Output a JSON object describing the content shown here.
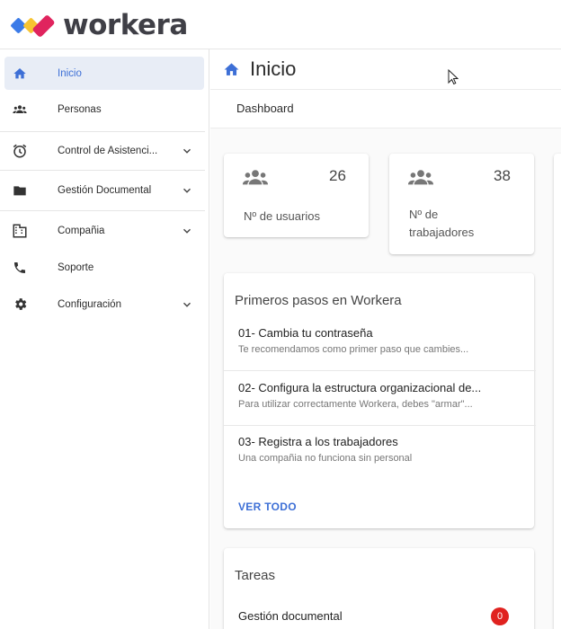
{
  "brand": {
    "name": "workera",
    "colors": {
      "blue": "#3b7be8",
      "yellow": "#f7c431",
      "red": "#e0245e"
    }
  },
  "sidebar": {
    "items": [
      {
        "label": "Inicio",
        "icon": "home-icon",
        "active": true
      },
      {
        "label": "Personas",
        "icon": "people-icon"
      },
      {
        "label": "Control de Asistenci...",
        "icon": "alarm-clock-icon",
        "expandable": true
      },
      {
        "label": "Gestión Documental",
        "icon": "folder-icon",
        "expandable": true
      },
      {
        "label": "Compañia",
        "icon": "building-icon",
        "expandable": true
      },
      {
        "label": "Soporte",
        "icon": "phone-icon"
      },
      {
        "label": "Configuración",
        "icon": "gear-icon",
        "expandable": true
      }
    ]
  },
  "page": {
    "title": "Inicio",
    "tab": "Dashboard"
  },
  "stats": [
    {
      "value": "26",
      "label": "Nº de usuarios"
    },
    {
      "value": "38",
      "label": "Nº de trabajadores"
    }
  ],
  "steps": {
    "title": "Primeros pasos en Workera",
    "items": [
      {
        "title": "01- Cambia tu contraseña",
        "desc": "Te recomendamos como primer paso que cambies..."
      },
      {
        "title": "02- Configura la estructura organizacional de...",
        "desc": "Para utilizar correctamente Workera, debes \"armar\"..."
      },
      {
        "title": "03- Registra a los trabajadores",
        "desc": "Una compañia no funciona sin personal"
      }
    ],
    "see_all": "VER TODO"
  },
  "tasks": {
    "title": "Tareas",
    "items": [
      {
        "label": "Gestión documental",
        "count": "0"
      }
    ]
  },
  "accent": "#3d6fd6"
}
